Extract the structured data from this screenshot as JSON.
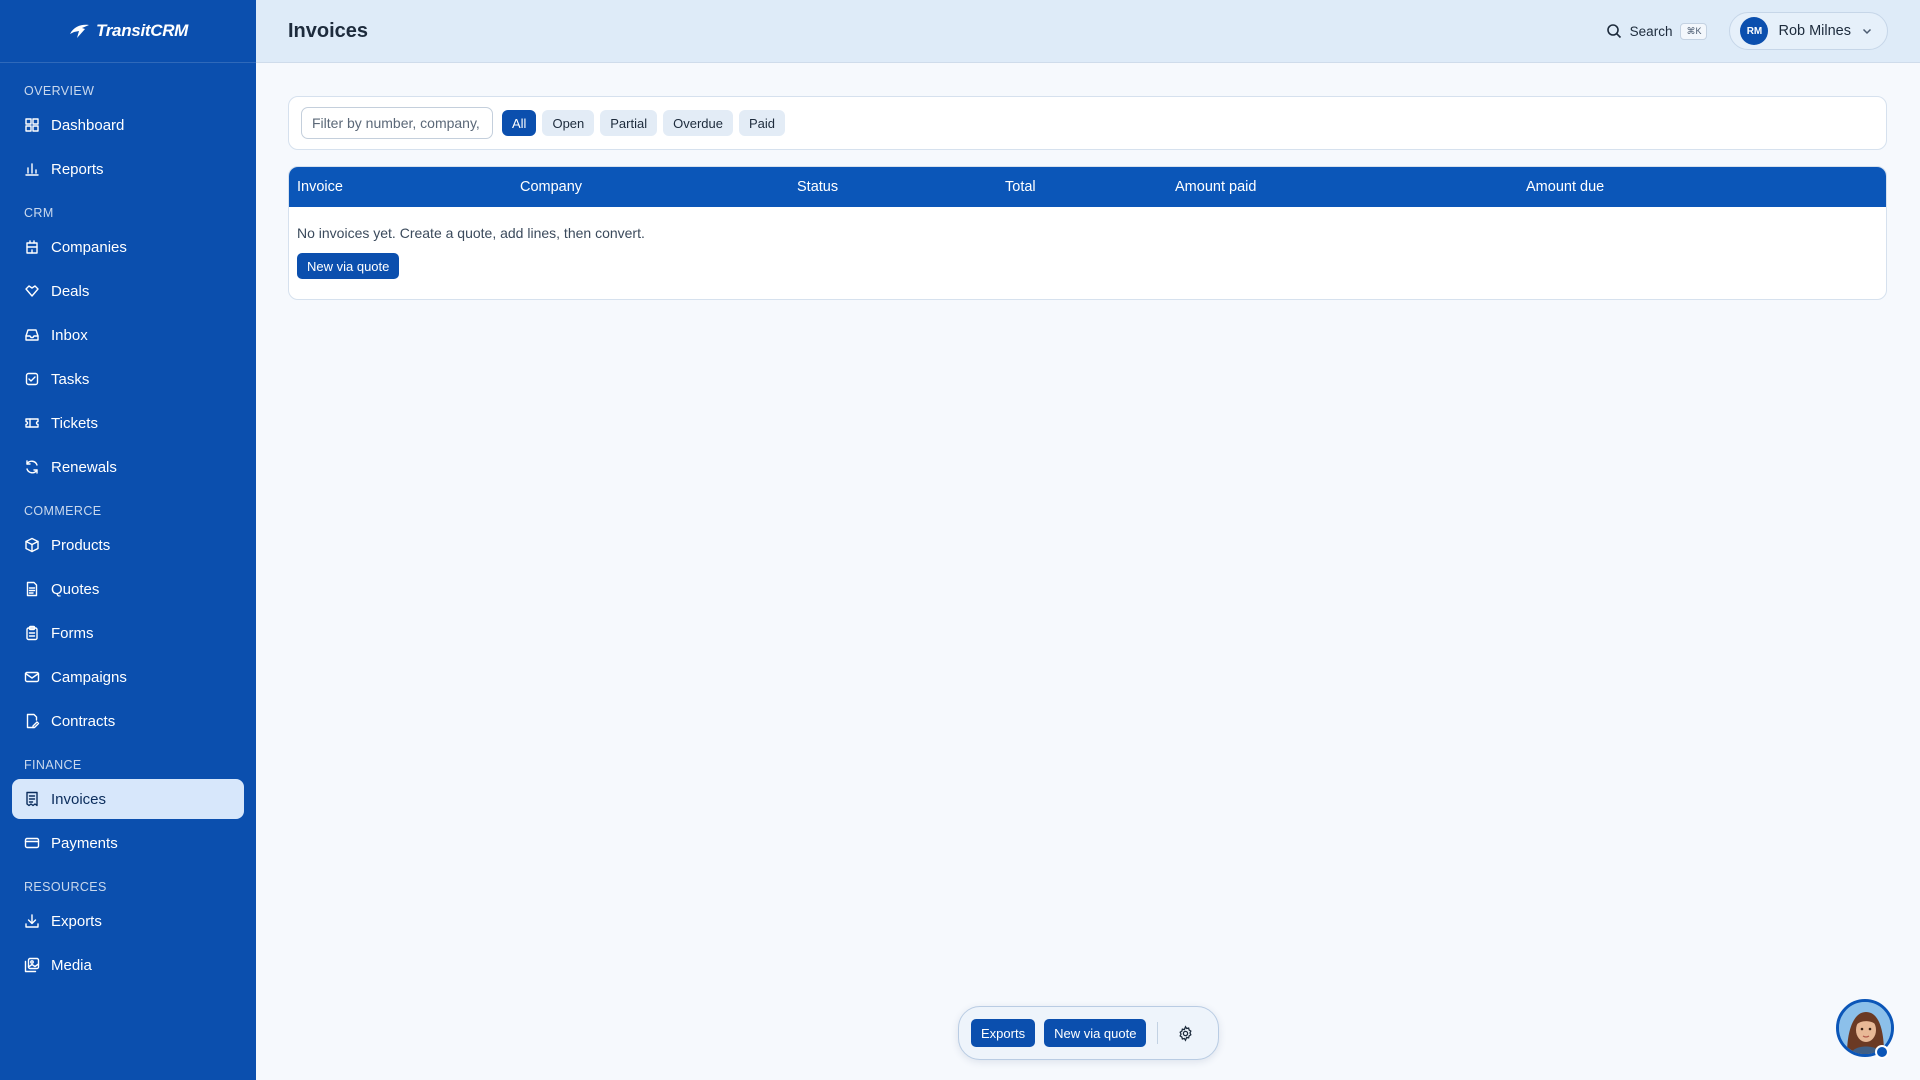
{
  "brand": {
    "name": "TransitCRM"
  },
  "sidebar": {
    "sections": [
      {
        "label": "OVERVIEW",
        "items": [
          {
            "label": "Dashboard",
            "icon": "grid-icon"
          },
          {
            "label": "Reports",
            "icon": "bar-chart-icon"
          }
        ]
      },
      {
        "label": "CRM",
        "items": [
          {
            "label": "Companies",
            "icon": "building-icon"
          },
          {
            "label": "Deals",
            "icon": "handshake-icon"
          },
          {
            "label": "Inbox",
            "icon": "inbox-icon"
          },
          {
            "label": "Tasks",
            "icon": "check-square-icon"
          },
          {
            "label": "Tickets",
            "icon": "ticket-icon"
          },
          {
            "label": "Renewals",
            "icon": "refresh-icon"
          }
        ]
      },
      {
        "label": "COMMERCE",
        "items": [
          {
            "label": "Products",
            "icon": "package-icon"
          },
          {
            "label": "Quotes",
            "icon": "file-text-icon"
          },
          {
            "label": "Forms",
            "icon": "clipboard-icon"
          },
          {
            "label": "Campaigns",
            "icon": "mail-icon"
          },
          {
            "label": "Contracts",
            "icon": "file-edit-icon"
          }
        ]
      },
      {
        "label": "FINANCE",
        "items": [
          {
            "label": "Invoices",
            "icon": "receipt-icon",
            "active": true
          },
          {
            "label": "Payments",
            "icon": "credit-card-icon"
          }
        ]
      },
      {
        "label": "RESOURCES",
        "items": [
          {
            "label": "Exports",
            "icon": "download-icon"
          },
          {
            "label": "Media",
            "icon": "images-icon"
          }
        ]
      }
    ]
  },
  "header": {
    "title": "Invoices",
    "search_label": "Search",
    "search_shortcut": "⌘K",
    "user": {
      "initials": "RM",
      "name": "Rob Milnes"
    }
  },
  "filters": {
    "placeholder": "Filter by number, company, ...",
    "chips": [
      "All",
      "Open",
      "Partial",
      "Overdue",
      "Paid"
    ],
    "active": "All"
  },
  "table": {
    "columns": [
      "Invoice",
      "Company",
      "Status",
      "Total",
      "Amount paid",
      "Amount due"
    ],
    "empty_message": "No invoices yet. Create a quote, add lines, then convert.",
    "empty_action": "New via quote"
  },
  "action_bar": {
    "exports_label": "Exports",
    "new_label": "New via quote"
  },
  "colors": {
    "sidebar": "#0b4fae",
    "accent": "#0b56b8",
    "active_nav_bg": "#d7e7fb"
  }
}
